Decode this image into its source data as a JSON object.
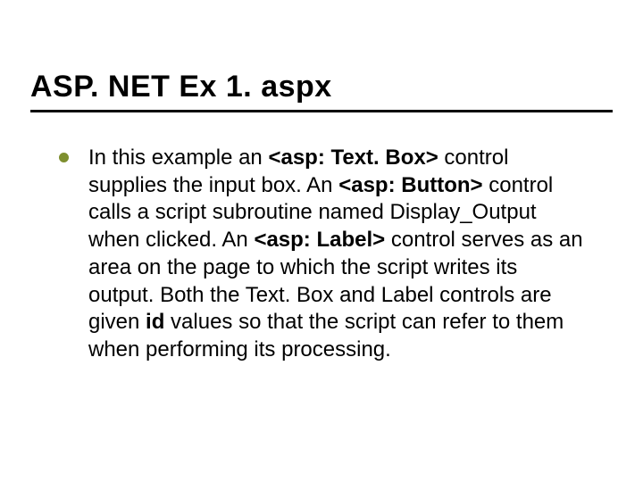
{
  "slide": {
    "title": "ASP. NET Ex 1. aspx",
    "bullet": {
      "segments": [
        {
          "text": "In this example an ",
          "bold": false
        },
        {
          "text": "<asp: Text. Box>",
          "bold": true
        },
        {
          "text": " control supplies the input box. An ",
          "bold": false
        },
        {
          "text": "<asp: Button>",
          "bold": true
        },
        {
          "text": " control calls a script subroutine named Display_Output when clicked. An ",
          "bold": false
        },
        {
          "text": "<asp: Label>",
          "bold": true
        },
        {
          "text": " control serves as an area on the page to which the script writes its output. Both the Text. Box and Label controls are given ",
          "bold": false
        },
        {
          "text": "id",
          "bold": true
        },
        {
          "text": " values so that the script can refer to them when performing its processing.",
          "bold": false
        }
      ]
    }
  }
}
